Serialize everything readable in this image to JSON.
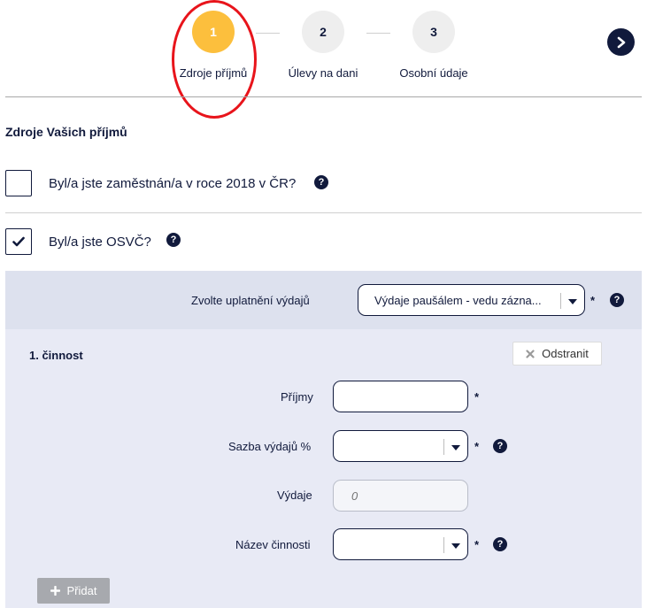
{
  "stepper": {
    "steps": [
      {
        "number": "1",
        "label": "Zdroje příjmů"
      },
      {
        "number": "2",
        "label": "Úlevy na dani"
      },
      {
        "number": "3",
        "label": "Osobní údaje"
      }
    ],
    "active_step": 1,
    "next_icon": "chevron-right-icon"
  },
  "section": {
    "title": "Zdroje Vašich příjmů"
  },
  "questions": [
    {
      "label": "Byl/a jste zaměstnán/a v roce 2018 v ČR?",
      "checked": false
    },
    {
      "label": "Byl/a jste OSVČ?",
      "checked": true
    }
  ],
  "help_symbol": "?",
  "required_mark": "*",
  "osvc_panel": {
    "expense_label": "Zvolte uplatnění výdajů",
    "expense_value": "Výdaje paušálem - vedu zázna...",
    "activity": {
      "title": "1. činnost",
      "remove_label": "Odstranit",
      "income_label": "Příjmy",
      "income_value": "",
      "rate_label": "Sazba výdajů %",
      "rate_value": "",
      "expenses_label": "Výdaje",
      "expenses_placeholder": "0",
      "name_label": "Název činnosti",
      "name_value": ""
    },
    "add_label": "Přidat"
  },
  "colors": {
    "navy": "#111a3c",
    "active_step": "#fcbf3d",
    "highlight": "#e8141b",
    "panel_head": "#dde1ee",
    "panel_body": "#e8eaf5"
  }
}
